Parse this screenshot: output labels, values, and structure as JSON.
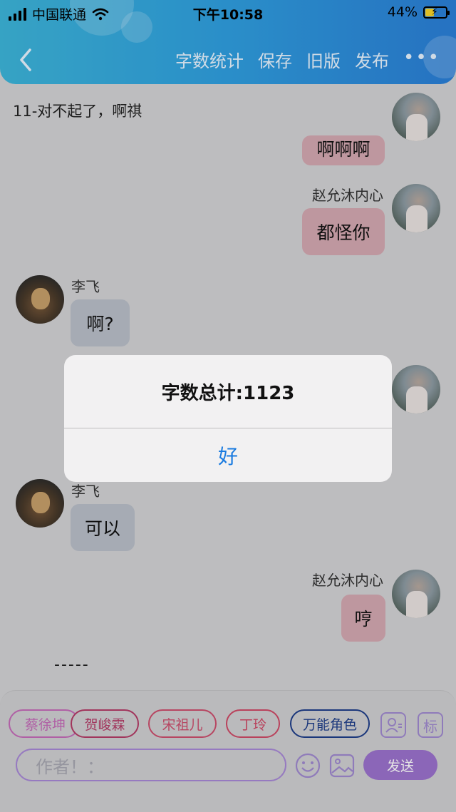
{
  "status_bar": {
    "carrier": "中国联通",
    "time": "下午10:58",
    "battery_percent": "44%",
    "battery_level": 0.44
  },
  "nav": {
    "actions": [
      "字数统计",
      "保存",
      "旧版",
      "发布"
    ],
    "more": "•••"
  },
  "page": {
    "title": "11-对不起了，啊祺"
  },
  "messages": [
    {
      "side": "right",
      "name": "",
      "text": "啊啊啊",
      "partial": true
    },
    {
      "side": "right",
      "name": "赵允沐内心",
      "text": "都怪你"
    },
    {
      "side": "left",
      "name": "李飞",
      "text": "啊?"
    },
    {
      "side": "left",
      "name": "李飞",
      "text": "可以"
    },
    {
      "side": "right",
      "name": "赵允沐内心",
      "text": "哼"
    }
  ],
  "divider_text": "-----",
  "dialog": {
    "message": "字数总计:1123",
    "ok_label": "好"
  },
  "roles": [
    {
      "label": "蔡徐坤",
      "color": "#c46bb8"
    },
    {
      "label": "贺峻霖",
      "color": "#b43b67"
    },
    {
      "label": "宋祖儿",
      "color": "#cc4f6e"
    },
    {
      "label": "丁玲",
      "color": "#cf4a67"
    },
    {
      "label": "万能角色",
      "color": "#1f3e8a"
    }
  ],
  "side_buttons": {
    "tag_label": "标"
  },
  "input": {
    "placeholder": "作者！："
  },
  "send_label": "发送",
  "colors": {
    "header_start": "#3db6db",
    "header_end": "#2b7fd8",
    "bubble_right": "#d4a9b2",
    "bubble_left": "#b9bfc9",
    "send_button": "#9b72cd",
    "dialog_ok": "#1a7be0"
  }
}
